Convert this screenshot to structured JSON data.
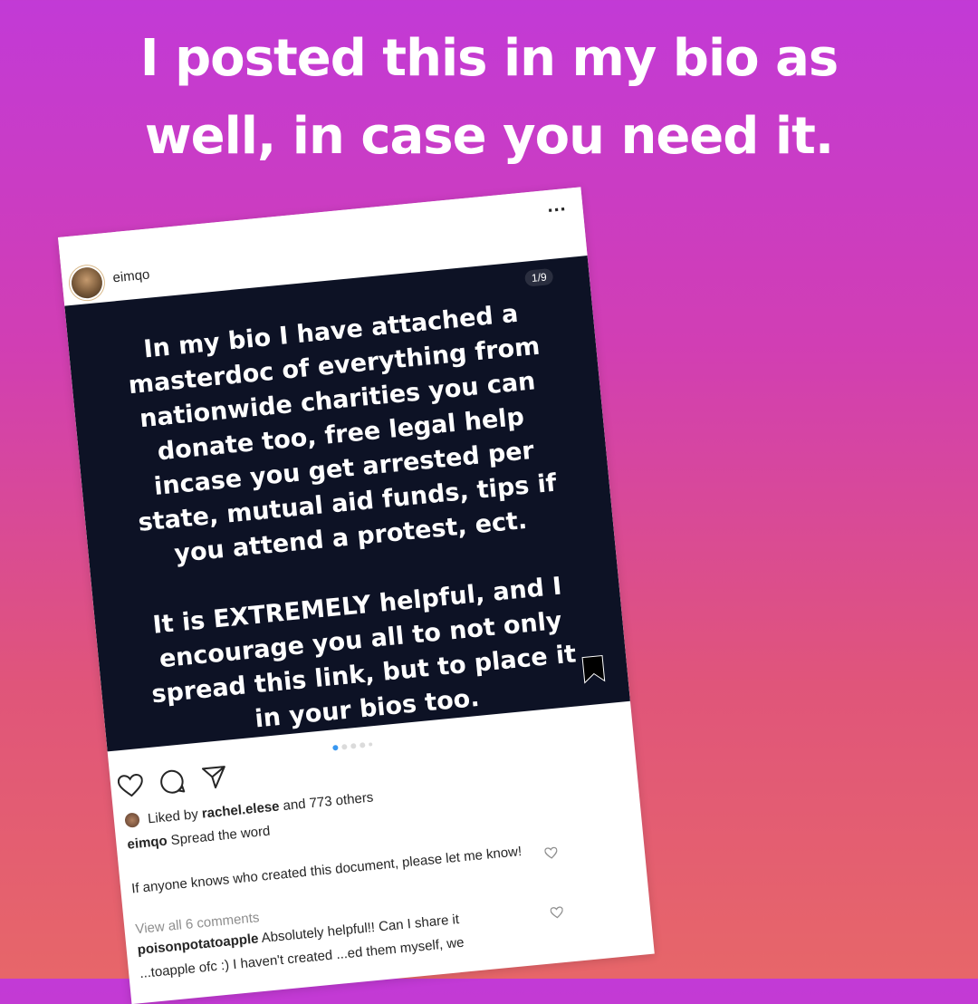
{
  "story": {
    "caption_line1": "I posted this in my bio as",
    "caption_line2": "well, in case you need it."
  },
  "post": {
    "username": "eimqo",
    "more_icon": "more-horizontal-icon",
    "slide_counter": "1/9",
    "slide_lines_1": [
      "In my bio I have attached a",
      "masterdoc of everything from",
      "nationwide charities you can",
      "donate too, free legal help",
      "incase you get arrested per",
      "state, mutual aid funds, tips if",
      "you attend a protest, ect."
    ],
    "slide_lines_2": [
      "It is EXTREMELY helpful, and I",
      "encourage you all to not only",
      "spread this link, but to place it",
      "in your bios too."
    ],
    "likes": {
      "prefix": "Liked by",
      "user": "rachel.elese",
      "suffix": "and 773 others"
    },
    "caption": {
      "user": "eimqo",
      "text": "Spread the word"
    },
    "comments": [
      {
        "user": "",
        "text": "If anyone knows who created this document, please let me know!"
      },
      {
        "user": "poisonpotatoapple",
        "text": "Absolutely helpful!! Can I share it"
      },
      {
        "user": "",
        "text": "...toapple ofc :) I haven't created ...ed them myself, we"
      }
    ],
    "view_all_comments": "View all 6 comments",
    "colors": {
      "slide_background": "#0d1225",
      "active_dot": "#3897f0"
    }
  }
}
